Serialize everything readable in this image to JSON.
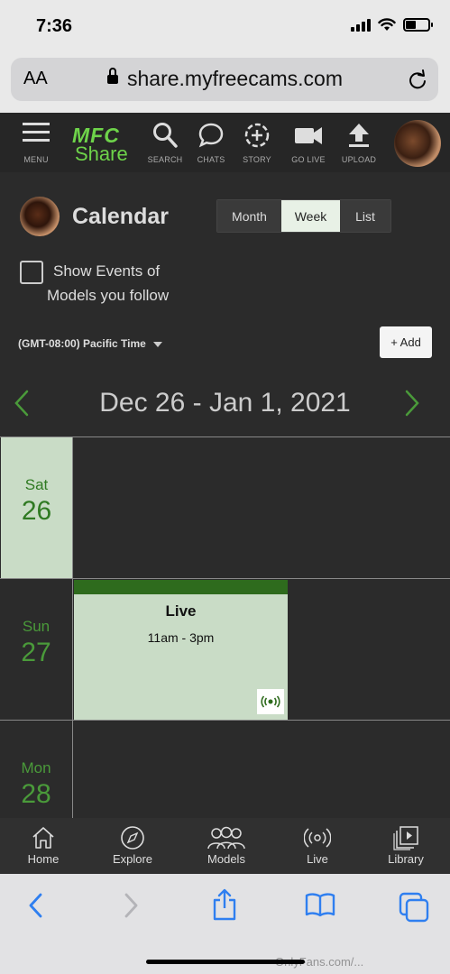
{
  "status_bar": {
    "time": "7:36"
  },
  "browser": {
    "aa_label": "AA",
    "url": "share.myfreecams.com"
  },
  "header": {
    "logo_top": "MFC",
    "logo_bottom": "Share",
    "nav": [
      {
        "label": "MENU",
        "icon": "hamburger-icon"
      },
      {
        "label": "SEARCH",
        "icon": "search-icon"
      },
      {
        "label": "CHATS",
        "icon": "chat-icon"
      },
      {
        "label": "STORY",
        "icon": "story-icon"
      },
      {
        "label": "GO LIVE",
        "icon": "camera-icon"
      },
      {
        "label": "UPLOAD",
        "icon": "upload-icon"
      }
    ]
  },
  "calendar": {
    "title": "Calendar",
    "views": [
      "Month",
      "Week",
      "List"
    ],
    "selected_view": "Week",
    "follow_line1": "Show Events of",
    "follow_line2": "Models you follow",
    "follow_checked": false,
    "timezone": "(GMT-08:00) Pacific Time",
    "add_label": "+ Add",
    "range": "Dec 26 - Jan 1, 2021",
    "days": [
      {
        "name": "Sat",
        "num": "26",
        "today": true
      },
      {
        "name": "Sun",
        "num": "27",
        "today": false
      },
      {
        "name": "Mon",
        "num": "28",
        "today": false
      }
    ],
    "event": {
      "title": "Live",
      "time": "11am - 3pm",
      "icon": "broadcast-icon"
    }
  },
  "tabbar": [
    {
      "label": "Home",
      "icon": "home-icon"
    },
    {
      "label": "Explore",
      "icon": "compass-icon"
    },
    {
      "label": "Models",
      "icon": "people-icon"
    },
    {
      "label": "Live",
      "icon": "broadcast-icon"
    },
    {
      "label": "Library",
      "icon": "library-icon"
    }
  ],
  "watermark": "OnlyFans.com/..."
}
